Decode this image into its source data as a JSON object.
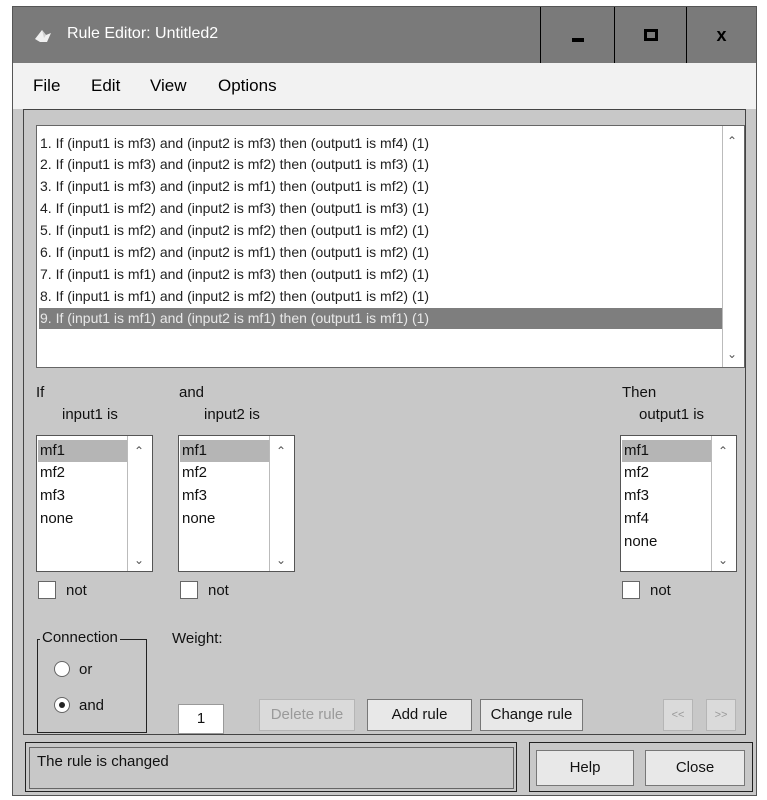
{
  "window": {
    "title": "Rule Editor: Untitled2",
    "controls": [
      "minimize-icon",
      "maximize-icon",
      "close-icon"
    ],
    "close_glyph": "x"
  },
  "menu": [
    "File",
    "Edit",
    "View",
    "Options"
  ],
  "rules": [
    "1. If (input1 is mf3) and (input2 is mf3) then (output1 is mf4) (1)",
    "2. If (input1 is mf3) and (input2 is mf2) then (output1 is mf3) (1)",
    "3. If (input1 is mf3) and (input2 is mf1) then (output1 is mf2) (1)",
    "4. If (input1 is mf2) and (input2 is mf3) then (output1 is mf3) (1)",
    "5. If (input1 is mf2) and (input2 is mf2) then (output1 is mf2) (1)",
    "6. If (input1 is mf2) and (input2 is mf1) then (output1 is mf2) (1)",
    "7. If (input1 is mf1) and (input2 is mf3) then (output1 is mf2) (1)",
    "8. If (input1 is mf1) and (input2 is mf2) then (output1 is mf2) (1)",
    "9. If (input1 is mf1) and (input2 is mf1) then (output1 is mf1) (1)"
  ],
  "selected_rule_index": 8,
  "if_block": {
    "header": "If",
    "label": "input1 is",
    "options": [
      "mf1",
      "mf2",
      "mf3",
      "none"
    ],
    "selected": "mf1",
    "not_label": "not"
  },
  "and_block": {
    "header": "and",
    "label": "input2 is",
    "options": [
      "mf1",
      "mf2",
      "mf3",
      "none"
    ],
    "selected": "mf1",
    "not_label": "not"
  },
  "then_block": {
    "header": "Then",
    "label": "output1 is",
    "options": [
      "mf1",
      "mf2",
      "mf3",
      "mf4",
      "none"
    ],
    "selected": "mf1",
    "not_label": "not"
  },
  "connection": {
    "title": "Connection",
    "options": [
      "or",
      "and"
    ],
    "selected": "and"
  },
  "weight": {
    "label": "Weight:",
    "value": "1"
  },
  "buttons": {
    "delete_rule": "Delete rule",
    "add_rule": "Add rule",
    "change_rule": "Change rule",
    "prev": "<<",
    "next": ">>",
    "help": "Help",
    "close": "Close"
  },
  "status": "The rule is changed",
  "colors": {
    "titlebar": "#7a7a7a",
    "background": "#c8c8c8",
    "selected_rule": "#7e7e7e",
    "selected_item": "#b5b5b5"
  }
}
